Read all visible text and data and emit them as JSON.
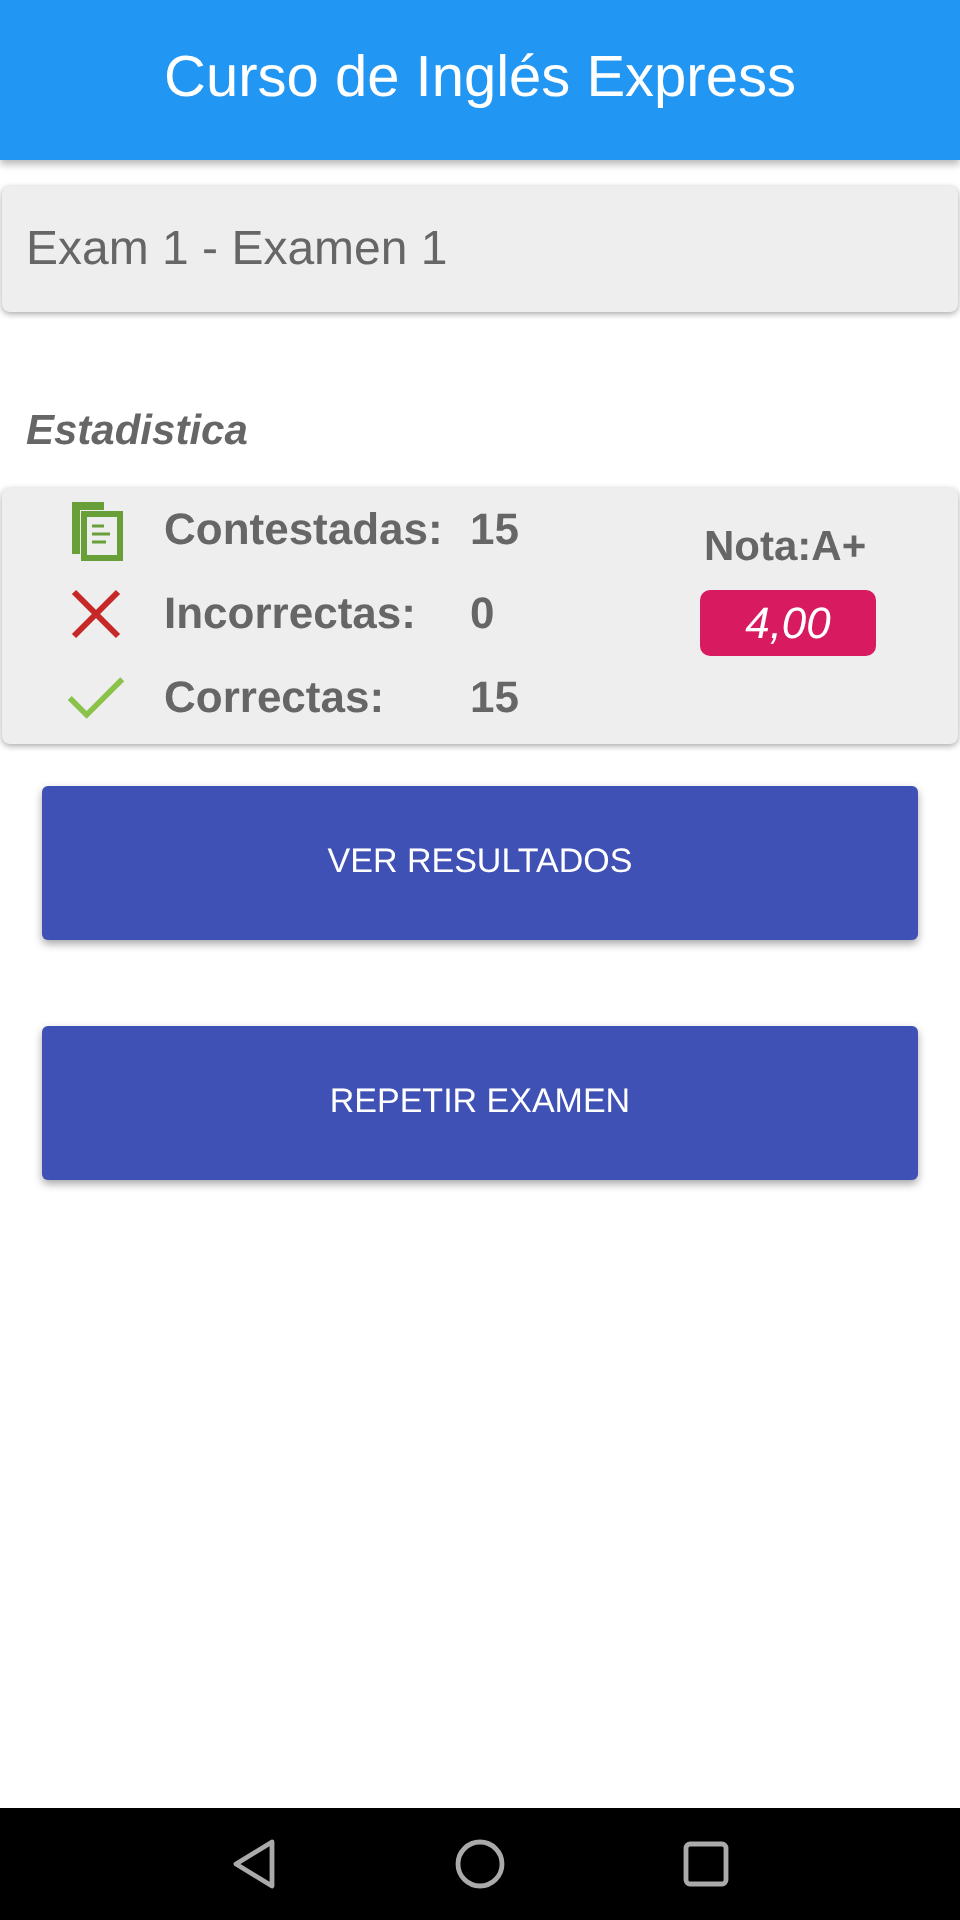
{
  "app_bar": {
    "title": "Curso de Inglés Express"
  },
  "exam_field": {
    "value": "Exam 1 - Examen 1"
  },
  "section_title": "Estadistica",
  "stats": [
    {
      "kind": "answered",
      "label": "Contestadas:",
      "value": "15"
    },
    {
      "kind": "wrong",
      "label": "Incorrectas:",
      "value": "0"
    },
    {
      "kind": "right",
      "label": "Correctas:",
      "value": "15"
    }
  ],
  "grade": {
    "label": "Nota:A+",
    "score": "4,00"
  },
  "buttons": [
    "VER RESULTADOS",
    "REPETIR EXAMEN"
  ]
}
